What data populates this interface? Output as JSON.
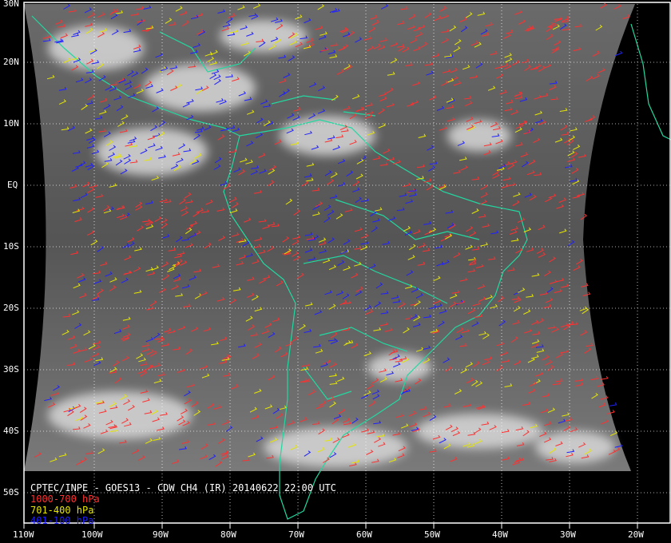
{
  "title": "CPTEC/INPE - GOES13 - CDW CH4 (IR) 20140622 22:00 UTC",
  "legend": [
    {
      "text": "1000-700 hPa",
      "color": "#ff3030"
    },
    {
      "text": "701-400 hPa",
      "color": "#e6e600"
    },
    {
      "text": "401-100 hPa",
      "color": "#2020ff"
    }
  ],
  "latitude_labels": [
    "30N",
    "20N",
    "10N",
    "EQ",
    "10S",
    "20S",
    "30S",
    "40S",
    "50S"
  ],
  "longitude_labels": [
    "110W",
    "100W",
    "90W",
    "80W",
    "70W",
    "60W",
    "50W",
    "40W",
    "30W",
    "20W"
  ],
  "colors": {
    "background": "#000000",
    "grid": "#ffffff",
    "coastline": "#22d8a0"
  }
}
